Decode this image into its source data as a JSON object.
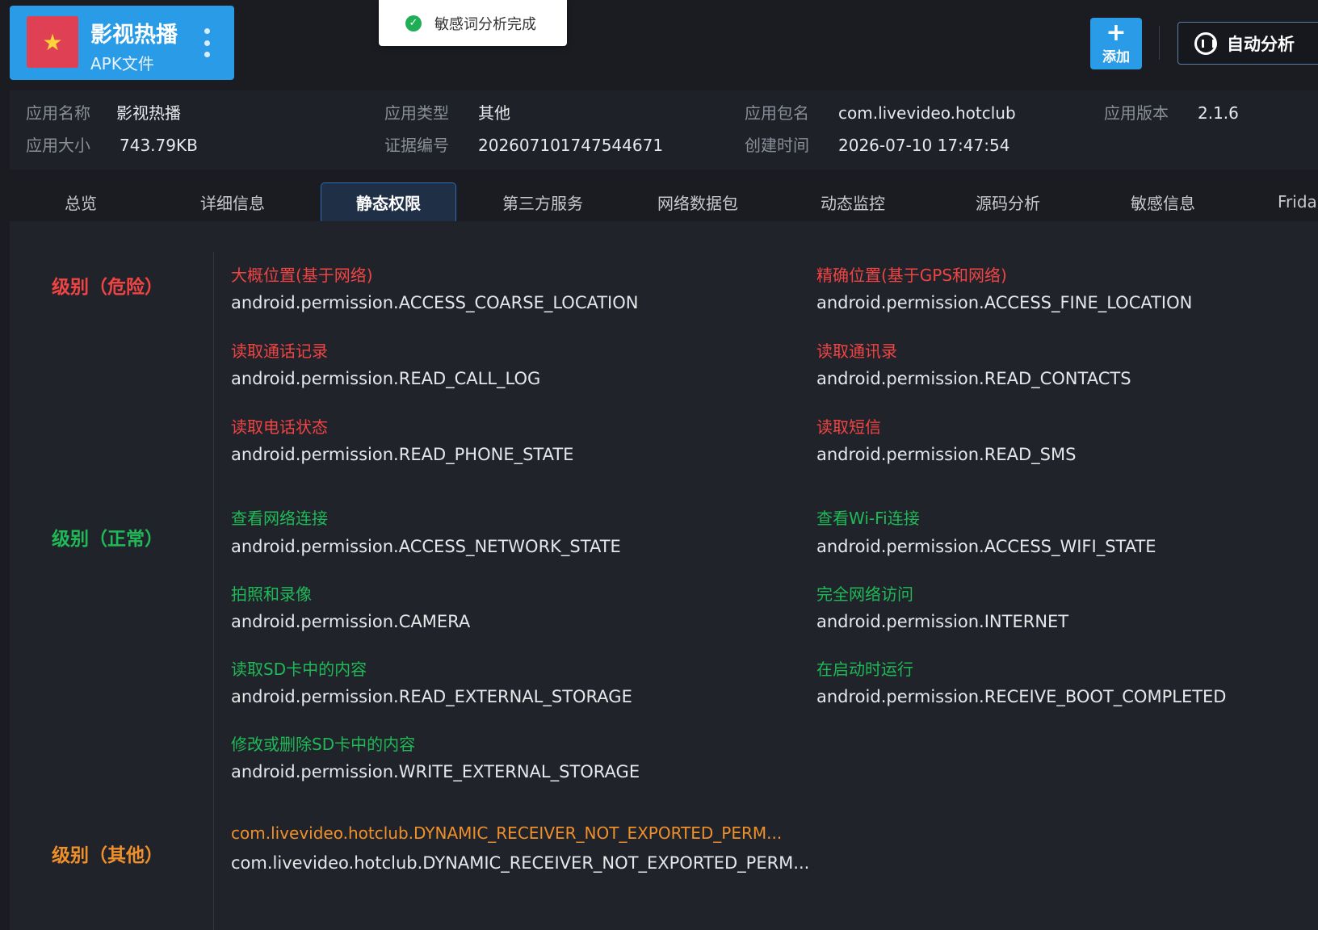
{
  "app": {
    "name": "影视热播",
    "type": "APK文件",
    "logo_icon": "star-flag-icon"
  },
  "toast": {
    "text": "敏感词分析完成",
    "icon": "check-circle-icon",
    "icon_color": "#1fad55"
  },
  "toolbar": {
    "add_label": "添加",
    "auto_label": "自动分析"
  },
  "info": {
    "items": [
      {
        "label": "应用名称",
        "value": "影视热播"
      },
      {
        "label": "应用类型",
        "value": "其他"
      },
      {
        "label": "应用包名",
        "value": "com.livevideo.hotclub"
      },
      {
        "label": "应用版本",
        "value": "2.1.6"
      },
      {
        "label": "应用大小",
        "value": "743.79KB"
      },
      {
        "label": "证据编号",
        "value": "202607101747544671"
      },
      {
        "label": "创建时间",
        "value": "2026-07-10 17:47:54"
      }
    ]
  },
  "tabs": [
    {
      "label": "总览"
    },
    {
      "label": "详细信息"
    },
    {
      "label": "静态权限",
      "active": true
    },
    {
      "label": "第三方服务"
    },
    {
      "label": "网络数据包"
    },
    {
      "label": "动态监控"
    },
    {
      "label": "源码分析"
    },
    {
      "label": "敏感信息"
    },
    {
      "label": "Frida"
    }
  ],
  "levels": {
    "danger": {
      "label": "级别（危险）",
      "color": "#f04444",
      "perms": [
        {
          "title": "大概位置(基于网络)",
          "name": "android.permission.ACCESS_COARSE_LOCATION"
        },
        {
          "title": "精确位置(基于GPS和网络)",
          "name": "android.permission.ACCESS_FINE_LOCATION"
        },
        {
          "title": "读取通话记录",
          "name": "android.permission.READ_CALL_LOG"
        },
        {
          "title": "读取通讯录",
          "name": "android.permission.READ_CONTACTS"
        },
        {
          "title": "读取电话状态",
          "name": "android.permission.READ_PHONE_STATE"
        },
        {
          "title": "读取短信",
          "name": "android.permission.READ_SMS"
        }
      ]
    },
    "normal": {
      "label": "级别（正常）",
      "color": "#1fb957",
      "perms": [
        {
          "title": "查看网络连接",
          "name": "android.permission.ACCESS_NETWORK_STATE"
        },
        {
          "title": "查看Wi-Fi连接",
          "name": "android.permission.ACCESS_WIFI_STATE"
        },
        {
          "title": "拍照和录像",
          "name": "android.permission.CAMERA"
        },
        {
          "title": "完全网络访问",
          "name": "android.permission.INTERNET"
        },
        {
          "title": "读取SD卡中的内容",
          "name": "android.permission.READ_EXTERNAL_STORAGE"
        },
        {
          "title": "在启动时运行",
          "name": "android.permission.RECEIVE_BOOT_COMPLETED"
        },
        {
          "title": "修改或删除SD卡中的内容",
          "name": "android.permission.WRITE_EXTERNAL_STORAGE"
        }
      ]
    },
    "other": {
      "label": "级别（其他）",
      "color": "#f0902a",
      "perms": [
        {
          "title": "com.livevideo.hotclub.DYNAMIC_RECEIVER_NOT_EXPORTED_PERM...",
          "name": "com.livevideo.hotclub.DYNAMIC_RECEIVER_NOT_EXPORTED_PERM..."
        }
      ]
    }
  }
}
